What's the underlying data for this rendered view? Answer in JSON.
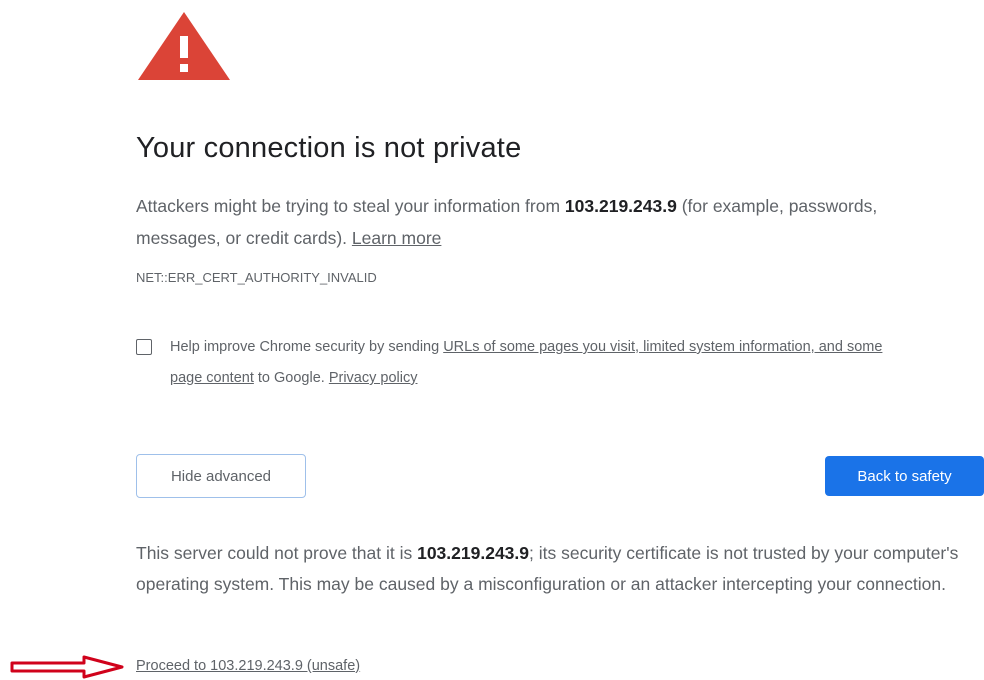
{
  "interstitial": {
    "title": "Your connection is not private",
    "intro": {
      "prefix": "Attackers might be trying to steal your information from ",
      "host": "103.219.243.9",
      "suffix": " (for example, passwords, messages, or credit cards). ",
      "learn_more": "Learn more"
    },
    "error_code": "NET::ERR_CERT_AUTHORITY_INVALID",
    "optin": {
      "prefix": "Help improve Chrome security by sending ",
      "urls_link": "URLs of some pages you visit, limited system information, and some page content",
      "middle": " to Google. ",
      "privacy_link": "Privacy policy",
      "checked": false
    },
    "buttons": {
      "hide_advanced": "Hide advanced",
      "back_to_safety": "Back to safety"
    },
    "details": {
      "prefix": "This server could not prove that it is ",
      "host": "103.219.243.9",
      "suffix": "; its security certificate is not trusted by your computer's operating system. This may be caused by a misconfiguration or an attacker intercepting your connection."
    },
    "proceed_link": "Proceed to 103.219.243.9 (unsafe)"
  },
  "icons": {
    "warning": "warning-triangle-icon",
    "annotation": "red-arrow-icon"
  },
  "colors": {
    "warning_red": "#db4437",
    "primary_blue": "#1a73e8",
    "text_secondary": "#5f6368",
    "annotation_red": "#d0021b"
  }
}
